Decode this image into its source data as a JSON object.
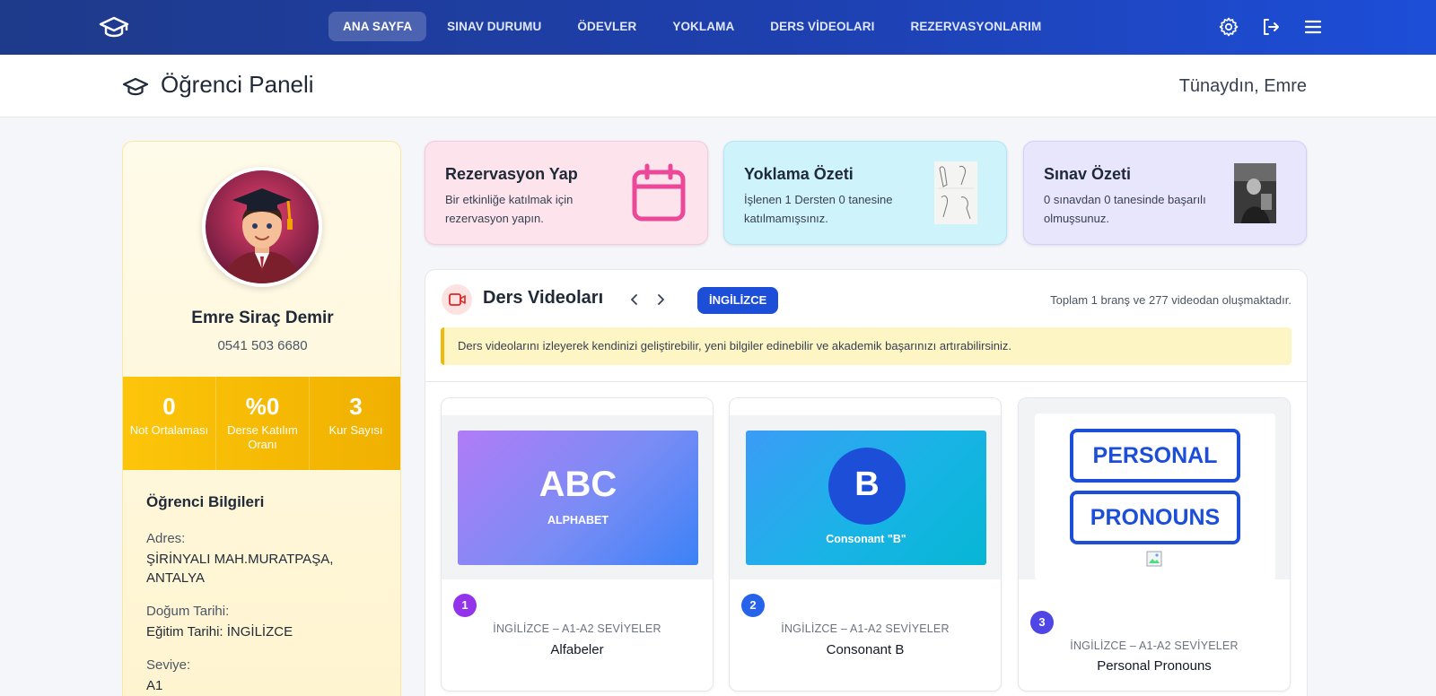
{
  "nav": {
    "items": [
      {
        "label": "ANA SAYFA",
        "active": true
      },
      {
        "label": "SINAV DURUMU"
      },
      {
        "label": "ÖDEVLER"
      },
      {
        "label": "YOKLAMA"
      },
      {
        "label": "DERS VİDEOLARI"
      },
      {
        "label": "REZERVASYONLARIM"
      }
    ],
    "icons": [
      "graduation-cap-icon",
      "gear-icon",
      "logout-icon",
      "menu-icon"
    ]
  },
  "header": {
    "title": "Öğrenci Paneli",
    "greeting": "Tünaydın, Emre"
  },
  "profile": {
    "name": "Emre Siraç Demir",
    "phone": "0541 503 6680",
    "stats": [
      {
        "value": "0",
        "label": "Not Ortalaması"
      },
      {
        "value": "%0",
        "label": "Derse Katılım Oranı"
      },
      {
        "value": "3",
        "label": "Kur Sayısı"
      }
    ],
    "info_title": "Öğrenci Bilgileri",
    "fields": [
      {
        "label": "Adres:",
        "value": "ŞİRİNYALI MAH.MURATPAŞA, ANTALYA"
      },
      {
        "label": "Doğum Tarihi:",
        "value": "Eğitim Tarihi: İNGİLİZCE"
      },
      {
        "label": "Seviye:",
        "value": "A1"
      }
    ]
  },
  "cards": [
    {
      "title": "Rezervasyon Yap",
      "desc": "Bir etkinliğe katılmak için rezervasyon yapın.",
      "color": "#ec4899"
    },
    {
      "title": "Yoklama Özeti",
      "desc": "İşlenen 1 Dersten 0 tanesine katılmamışsınız."
    },
    {
      "title": "Sınav Özeti",
      "desc": "0 sınavdan 0 tanesinde başarılı olmuşsunuz."
    }
  ],
  "videos": {
    "title": "Ders Videoları",
    "tag": "İNGİLİZCE",
    "total": "Toplam 1 branş ve 277 videodan oluşmaktadır.",
    "notice": "Ders videolarını izleyerek kendinizi geliştirebilir, yeni bilgiler edinebilir ve akademik başarınızı artırabilirsiniz.",
    "items": [
      {
        "num": "1",
        "category": "İNGİLİZCE – A1-A2 SEVİYELER",
        "name": "Alfabeler",
        "thumb_title": "ABC",
        "thumb_sub": "ALPHABET",
        "num_color": "#9333ea"
      },
      {
        "num": "2",
        "category": "İNGİLİZCE – A1-A2 SEVİYELER",
        "name": "Consonant B",
        "thumb_title": "B",
        "thumb_sub": "Consonant \"B\"",
        "num_color": "#2563eb"
      },
      {
        "num": "3",
        "category": "İNGİLİZCE – A1-A2 SEVİYELER",
        "name": "Personal Pronouns",
        "thumb_title": "PERSONAL",
        "thumb_sub": "PRONOUNS",
        "num_color": "#4f46e5"
      }
    ]
  }
}
